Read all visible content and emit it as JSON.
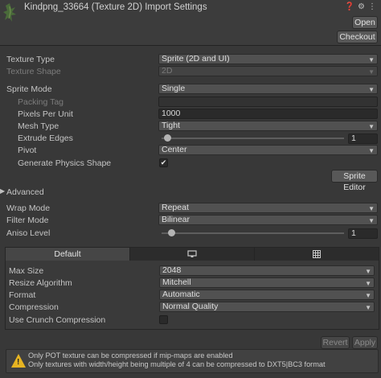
{
  "header": {
    "title": "Kindpng_33664 (Texture 2D) Import Settings",
    "icons": [
      "help-icon",
      "preset-icon",
      "more-icon"
    ],
    "open_label": "Open",
    "checkout_label": "Checkout"
  },
  "fields": {
    "texture_type": {
      "label": "Texture Type",
      "value": "Sprite (2D and UI)"
    },
    "texture_shape": {
      "label": "Texture Shape",
      "value": "2D"
    },
    "sprite_mode": {
      "label": "Sprite Mode",
      "value": "Single"
    },
    "packing_tag": {
      "label": "Packing Tag",
      "value": ""
    },
    "pixels_per_unit": {
      "label": "Pixels Per Unit",
      "value": "1000"
    },
    "mesh_type": {
      "label": "Mesh Type",
      "value": "Tight"
    },
    "extrude_edges": {
      "label": "Extrude Edges",
      "value": "1"
    },
    "pivot": {
      "label": "Pivot",
      "value": "Center"
    },
    "generate_physics_shape": {
      "label": "Generate Physics Shape",
      "checked": true,
      "check_glyph": "✔"
    },
    "sprite_editor_label": "Sprite Editor",
    "advanced_label": "Advanced",
    "wrap_mode": {
      "label": "Wrap Mode",
      "value": "Repeat"
    },
    "filter_mode": {
      "label": "Filter Mode",
      "value": "Bilinear"
    },
    "aniso_level": {
      "label": "Aniso Level",
      "value": "1"
    }
  },
  "platform": {
    "tabs": [
      {
        "label": "Default",
        "icon": null
      },
      {
        "label": "",
        "icon": "monitor-icon"
      },
      {
        "label": "",
        "icon": "grid-icon"
      }
    ],
    "max_size": {
      "label": "Max Size",
      "value": "2048"
    },
    "resize_algorithm": {
      "label": "Resize Algorithm",
      "value": "Mitchell"
    },
    "format": {
      "label": "Format",
      "value": "Automatic"
    },
    "compression": {
      "label": "Compression",
      "value": "Normal Quality"
    },
    "use_crunch": {
      "label": "Use Crunch Compression",
      "checked": false
    }
  },
  "footer": {
    "revert_label": "Revert",
    "apply_label": "Apply"
  },
  "warning": {
    "line1": "Only POT texture can be compressed if mip-maps are enabled",
    "line2": "Only textures with width/height being multiple of 4 can be compressed to DXT5|BC3 format"
  },
  "colors": {
    "background": "#383838",
    "warning": "#e6b422"
  }
}
